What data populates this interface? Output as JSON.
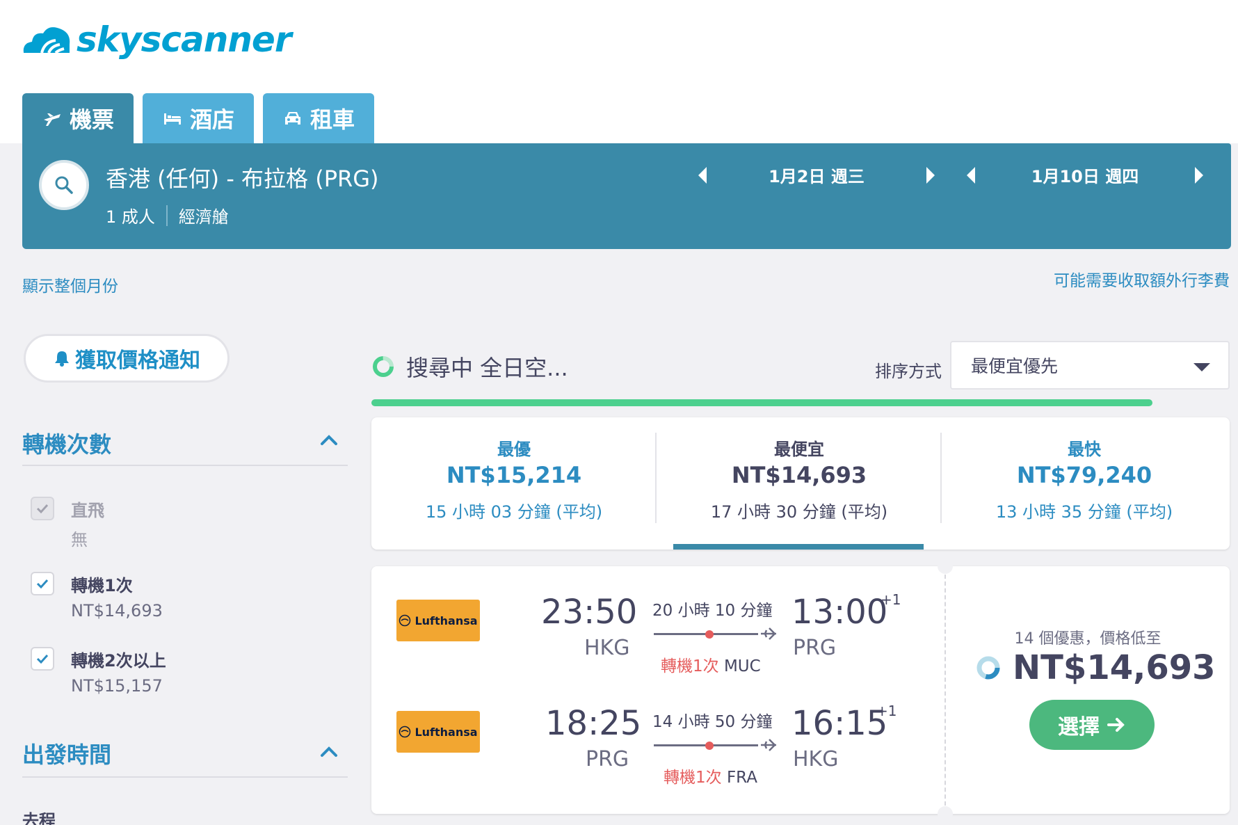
{
  "brand": {
    "name": "skyscanner",
    "color": "#02a0d2"
  },
  "tabs": [
    {
      "label": "機票",
      "icon": "plane-icon",
      "active": true
    },
    {
      "label": "酒店",
      "icon": "bed-icon",
      "active": false
    },
    {
      "label": "租車",
      "icon": "car-icon",
      "active": false
    }
  ],
  "search": {
    "route": "香港 (任何) - 布拉格 (PRG)",
    "passengers": "1 成人",
    "cabin": "經濟艙",
    "depart_date": "1月2日 週三",
    "return_date": "1月10日 週四"
  },
  "links": {
    "show_month": "顯示整個月份",
    "baggage_fee": "可能需要收取額外行李費"
  },
  "sidebar": {
    "price_alert": "獲取價格通知",
    "stops": {
      "title": "轉機次數",
      "options": [
        {
          "label": "直飛",
          "sub": "無",
          "checked": true,
          "disabled": true
        },
        {
          "label": "轉機1次",
          "sub": "NT$14,693",
          "checked": true,
          "disabled": false
        },
        {
          "label": "轉機2次以上",
          "sub": "NT$15,157",
          "checked": true,
          "disabled": false
        }
      ]
    },
    "depart_time": {
      "title": "出發時間",
      "first_item": "去程"
    }
  },
  "status": {
    "searching_text": "搜尋中 全日空...",
    "progress": 0.91
  },
  "sort": {
    "label": "排序方式",
    "value": "最便宜優先"
  },
  "summary": [
    {
      "label": "最優",
      "price": "NT$15,214",
      "duration": "15 小時 03 分鐘 (平均)",
      "selected": false
    },
    {
      "label": "最便宜",
      "price": "NT$14,693",
      "duration": "17 小時 30 分鐘 (平均)",
      "selected": true
    },
    {
      "label": "最快",
      "price": "NT$79,240",
      "duration": "13 小時 35 分鐘 (平均)",
      "selected": false
    }
  ],
  "result": {
    "legs": [
      {
        "airline": "Lufthansa",
        "dep_time": "23:50",
        "dep_code": "HKG",
        "duration": "20 小時 10 分鐘",
        "stops": "轉機1次",
        "via": "MUC",
        "arr_time": "13:00",
        "arr_code": "PRG",
        "day_offset": "+1"
      },
      {
        "airline": "Lufthansa",
        "dep_time": "18:25",
        "dep_code": "PRG",
        "duration": "14 小時 50 分鐘",
        "stops": "轉機1次",
        "via": "FRA",
        "arr_time": "16:15",
        "arr_code": "HKG",
        "day_offset": "+1"
      }
    ],
    "deals": "14 個優惠，價格低至",
    "price": "NT$14,693",
    "select_label": "選擇"
  },
  "colors": {
    "accent": "#3a8aa8",
    "tab": "#51afd9",
    "link": "#2c8cc1",
    "green": "#4cb87e",
    "stop": "#e55c5c",
    "lufthansa": "#f2a631"
  }
}
